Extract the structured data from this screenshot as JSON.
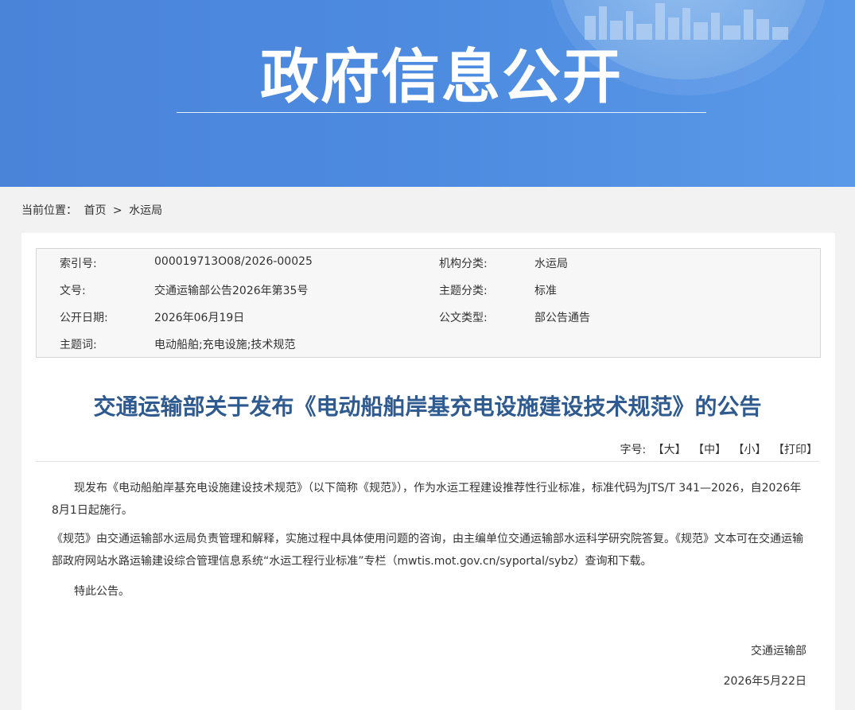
{
  "banner": {
    "title": "政府信息公开"
  },
  "breadcrumb": {
    "label": "当前位置：",
    "home": "首页",
    "sep": ">",
    "current": "水运局"
  },
  "meta": {
    "rows": [
      {
        "k1": "索引号:",
        "v1": "000019713O08/2026-00025",
        "k2": "机构分类:",
        "v2": "水运局"
      },
      {
        "k1": "文号:",
        "v1": "交通运输部公告2026年第35号",
        "k2": "主题分类:",
        "v2": "标准"
      },
      {
        "k1": "公开日期:",
        "v1": "2026年06月19日",
        "k2": "公文类型:",
        "v2": "部公告通告"
      },
      {
        "k1": "主题词:",
        "v1": "电动船舶;充电设施;技术规范",
        "k2": "",
        "v2": ""
      }
    ]
  },
  "doc": {
    "title": "交通运输部关于发布《电动船舶岸基充电设施建设技术规范》的公告",
    "tools": {
      "label": "字号:",
      "large": "【大】",
      "medium": "【中】",
      "small": "【小】",
      "print": "【打印】"
    },
    "paragraphs": [
      "现发布《电动船舶岸基充电设施建设技术规范》（以下简称《规范》），作为水运工程建设推荐性行业标准，标准代码为JTS/T 341—2026，自2026年8月1日起施行。",
      "《规范》由交通运输部水运局负责管理和解释，实施过程中具体使用问题的咨询，由主编单位交通运输部水运科学研究院答复。《规范》文本可在交通运输部政府网站水路运输建设综合管理信息系统“水运工程行业标准”专栏（mwtis.mot.gov.cn/syportal/sybz）查询和下载。",
      "特此公告。"
    ],
    "signature": "交通运输部",
    "date": "2026年5月22日"
  },
  "colors": {
    "banner": "#4d8be0",
    "title": "#2e5a8f"
  }
}
